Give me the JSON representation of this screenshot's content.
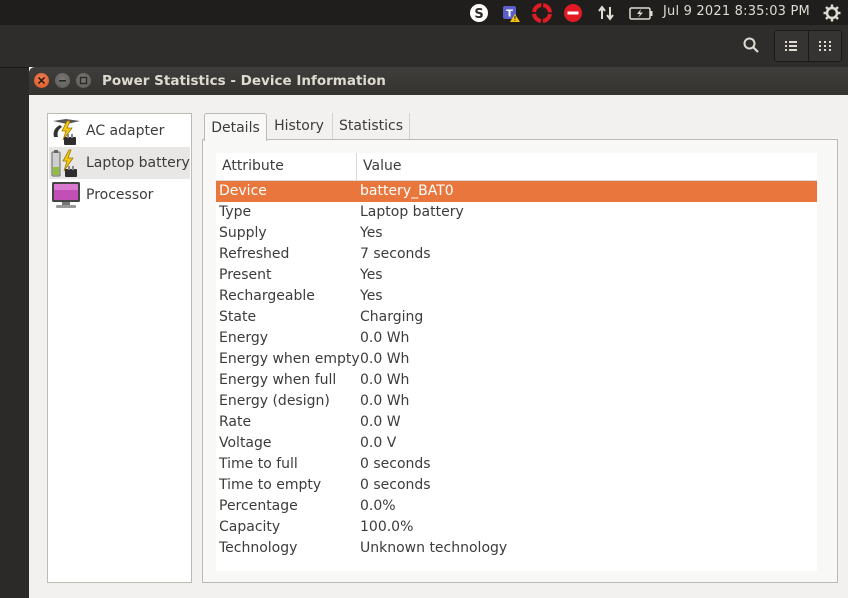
{
  "top_panel": {
    "clock": "Jul  9 2021  8:35:03 PM",
    "indicators": [
      "skype-icon",
      "teams-icon",
      "lifebuoy-icon",
      "no-entry-icon",
      "network-arrows-icon",
      "battery-charging-icon",
      "gear-icon"
    ]
  },
  "header_bar": {
    "buttons": [
      "search-icon",
      "list-view-icon",
      "grid-view-icon"
    ]
  },
  "window": {
    "title": "Power Statistics - Device Information"
  },
  "devices": [
    {
      "label": "AC adapter",
      "icon": "ac-adapter-icon",
      "selected": false
    },
    {
      "label": "Laptop battery",
      "icon": "laptop-battery-icon",
      "selected": true
    },
    {
      "label": "Processor",
      "icon": "processor-icon",
      "selected": false
    }
  ],
  "tabs": [
    {
      "label": "Details",
      "active": true
    },
    {
      "label": "History",
      "active": false
    },
    {
      "label": "Statistics",
      "active": false
    }
  ],
  "table": {
    "headers": {
      "attribute": "Attribute",
      "value": "Value"
    },
    "rows": [
      {
        "attribute": "Device",
        "value": "battery_BAT0"
      },
      {
        "attribute": "Type",
        "value": "Laptop battery"
      },
      {
        "attribute": "Supply",
        "value": "Yes"
      },
      {
        "attribute": "Refreshed",
        "value": "7 seconds"
      },
      {
        "attribute": "Present",
        "value": "Yes"
      },
      {
        "attribute": "Rechargeable",
        "value": "Yes"
      },
      {
        "attribute": "State",
        "value": "Charging"
      },
      {
        "attribute": "Energy",
        "value": "0.0 Wh"
      },
      {
        "attribute": "Energy when empty",
        "value": "0.0 Wh"
      },
      {
        "attribute": "Energy when full",
        "value": "0.0 Wh"
      },
      {
        "attribute": "Energy (design)",
        "value": "0.0 Wh"
      },
      {
        "attribute": "Rate",
        "value": "0.0 W"
      },
      {
        "attribute": "Voltage",
        "value": "0.0 V"
      },
      {
        "attribute": "Time to full",
        "value": "0 seconds"
      },
      {
        "attribute": "Time to empty",
        "value": "0 seconds"
      },
      {
        "attribute": "Percentage",
        "value": "0.0%"
      },
      {
        "attribute": "Capacity",
        "value": "100.0%"
      },
      {
        "attribute": "Technology",
        "value": "Unknown technology"
      }
    ]
  },
  "colors": {
    "selection": "#e9773d",
    "panel": "#1f1e1d",
    "window_bg": "#f2f1f0"
  }
}
